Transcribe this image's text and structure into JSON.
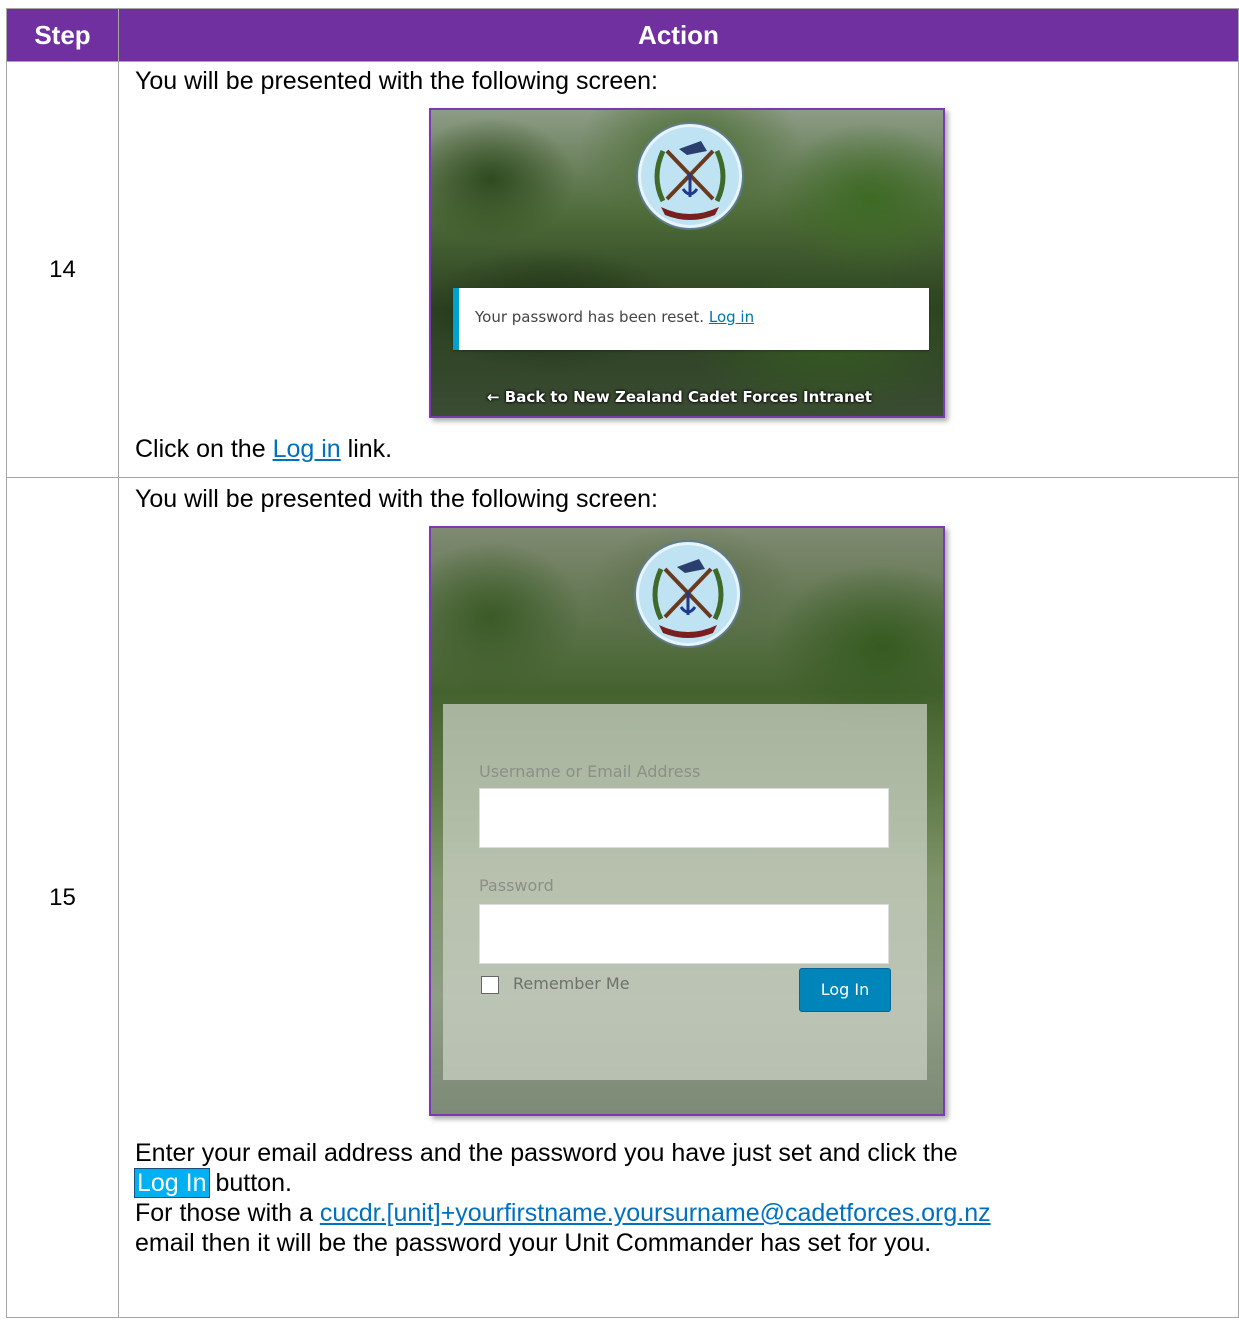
{
  "table": {
    "header_step": "Step",
    "header_action": "Action"
  },
  "rows": [
    {
      "step": "14",
      "intro": "You will be presented with the following screen:",
      "screen": {
        "notice_text": "Your password has been reset.",
        "notice_link": "Log in",
        "back_link": "← Back to New Zealand Cadet Forces Intranet"
      },
      "instruction_prefix": "Click on the ",
      "instruction_link": "Log in",
      "instruction_suffix": " link."
    },
    {
      "step": "15",
      "intro": "You will be presented with the following screen:",
      "screen": {
        "username_label": "Username or Email Address",
        "password_label": "Password",
        "remember_label": "Remember Me",
        "login_button": "Log In"
      },
      "instruction_line1": "Enter your email address and the password you have just set and click the",
      "instruction_button": "Log In",
      "instruction_line2_suffix": " button.",
      "note_prefix": "For those with a ",
      "note_link": "cucdr.[unit]+yourfirstname.yoursurname@cadetforces.org.nz",
      "note_line2": "email then it will be the password your Unit Commander has set for you."
    }
  ],
  "colors": {
    "header_bg": "#7030a0",
    "link": "#0070c0",
    "highlight": "#00b0f0",
    "wp_button": "#0085ba"
  }
}
